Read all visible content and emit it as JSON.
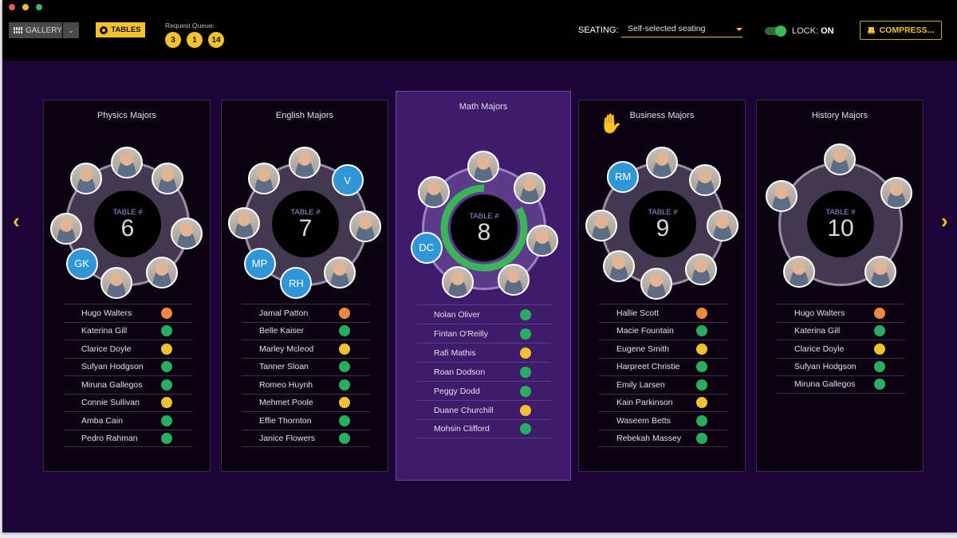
{
  "window_controls": [
    {
      "name": "close",
      "color": "#ee5a5a"
    },
    {
      "name": "minimize",
      "color": "#f2c12e"
    },
    {
      "name": "maximize",
      "color": "#3cb55a"
    }
  ],
  "toolbar": {
    "gallery_label": "GALLERY",
    "gallery_dropdown_glyph": "⌄",
    "tables_label": "TABLES",
    "request_queue_label": "Request Queue:",
    "request_queue": [
      "3",
      "1",
      "14"
    ],
    "seating_label": "SEATING:",
    "seating_value": "Self-selected seating",
    "lock_label": "LOCK:",
    "lock_value": "ON",
    "lock_on": true,
    "compress_label": "COMPRESS..."
  },
  "nav": {
    "prev_glyph": "‹",
    "next_glyph": "›"
  },
  "colors": {
    "accent": "#f2c12e",
    "green": "#27ae60",
    "yellow": "#f2c12e",
    "orange": "#f0883e",
    "initials_bg": "#2f96d8"
  },
  "table_label": "TABLE #",
  "tables": [
    {
      "title": "Physics Majors",
      "number": "6",
      "active": false,
      "raised_hand": false,
      "seats": [
        {
          "type": "photo"
        },
        {
          "type": "photo"
        },
        {
          "type": "photo"
        },
        {
          "type": "photo"
        },
        {
          "type": "photo"
        },
        {
          "type": "initials",
          "text": "GK"
        },
        {
          "type": "photo"
        },
        {
          "type": "photo"
        }
      ],
      "roster": [
        {
          "name": "Hugo Walters",
          "status": "orange"
        },
        {
          "name": "Katerina Gill",
          "status": "green"
        },
        {
          "name": "Clarice Doyle",
          "status": "yellow"
        },
        {
          "name": "Sufyan Hodgson",
          "status": "green"
        },
        {
          "name": "Miruna Gallegos",
          "status": "green"
        },
        {
          "name": "Connie Sullivan",
          "status": "yellow"
        },
        {
          "name": "Amba Cain",
          "status": "green"
        },
        {
          "name": "Pedro Rahman",
          "status": "green"
        }
      ]
    },
    {
      "title": "English Majors",
      "number": "7",
      "active": false,
      "raised_hand": false,
      "seats": [
        {
          "type": "photo"
        },
        {
          "type": "initials",
          "text": "V"
        },
        {
          "type": "photo"
        },
        {
          "type": "photo"
        },
        {
          "type": "initials",
          "text": "RH"
        },
        {
          "type": "initials",
          "text": "MP"
        },
        {
          "type": "photo"
        },
        {
          "type": "photo"
        }
      ],
      "roster": [
        {
          "name": "Jamal Patton",
          "status": "orange"
        },
        {
          "name": "Belle Kaiser",
          "status": "green"
        },
        {
          "name": "Marley Mcleod",
          "status": "yellow"
        },
        {
          "name": "Tanner Sloan",
          "status": "green"
        },
        {
          "name": "Romeo Huynh",
          "status": "green"
        },
        {
          "name": "Mehmet Poole",
          "status": "yellow"
        },
        {
          "name": "Effie Thornton",
          "status": "green"
        },
        {
          "name": "Janice Flowers",
          "status": "green"
        }
      ]
    },
    {
      "title": "Math Majors",
      "number": "8",
      "active": true,
      "raised_hand": false,
      "progress": 0.83,
      "seats": [
        {
          "type": "photo"
        },
        {
          "type": "photo"
        },
        {
          "type": "photo"
        },
        {
          "type": "photo"
        },
        {
          "type": "photo"
        },
        {
          "type": "initials",
          "text": "DC"
        },
        {
          "type": "photo"
        }
      ],
      "roster": [
        {
          "name": "Nolan Oliver",
          "status": "green"
        },
        {
          "name": "Fintan O'Reilly",
          "status": "green"
        },
        {
          "name": "Rafi Mathis",
          "status": "yellow"
        },
        {
          "name": "Roan Dodson",
          "status": "green"
        },
        {
          "name": "Peggy Dodd",
          "status": "green"
        },
        {
          "name": "Duane Churchill",
          "status": "yellow"
        },
        {
          "name": "Mohsin Clifford",
          "status": "green"
        }
      ]
    },
    {
      "title": "Business Majors",
      "number": "9",
      "active": false,
      "raised_hand": true,
      "seats": [
        {
          "type": "photo"
        },
        {
          "type": "photo"
        },
        {
          "type": "photo"
        },
        {
          "type": "photo"
        },
        {
          "type": "photo"
        },
        {
          "type": "photo"
        },
        {
          "type": "photo"
        },
        {
          "type": "initials",
          "text": "RM"
        }
      ],
      "roster": [
        {
          "name": "Hallie Scott",
          "status": "orange"
        },
        {
          "name": "Macie Fountain",
          "status": "green"
        },
        {
          "name": "Eugene Smith",
          "status": "yellow"
        },
        {
          "name": "Harpreet Christie",
          "status": "green"
        },
        {
          "name": "Emily Larsen",
          "status": "green"
        },
        {
          "name": "Kain Parkinson",
          "status": "yellow"
        },
        {
          "name": "Waseem Betts",
          "status": "green"
        },
        {
          "name": "Rebekah Massey",
          "status": "green"
        }
      ]
    },
    {
      "title": "History Majors",
      "number": "10",
      "active": false,
      "raised_hand": false,
      "seats": [
        {
          "type": "photo"
        },
        {
          "type": "photo"
        },
        {
          "type": "photo"
        },
        {
          "type": "photo"
        },
        {
          "type": "photo"
        }
      ],
      "roster": [
        {
          "name": "Hugo Walters",
          "status": "orange"
        },
        {
          "name": "Katerina Gill",
          "status": "green"
        },
        {
          "name": "Clarice Doyle",
          "status": "yellow"
        },
        {
          "name": "Sufyan Hodgson",
          "status": "green"
        },
        {
          "name": "Miruna Gallegos",
          "status": "green"
        }
      ]
    }
  ]
}
